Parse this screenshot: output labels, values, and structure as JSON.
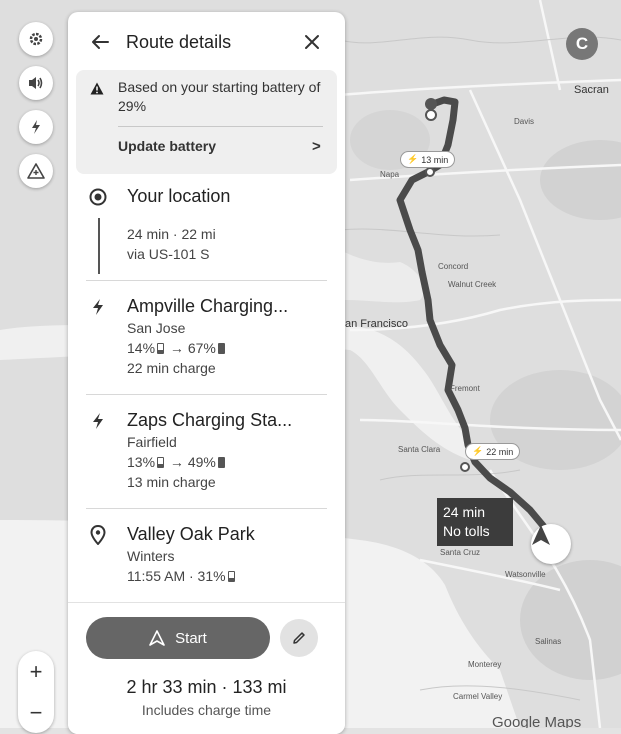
{
  "panel": {
    "title": "Route details",
    "battery_notice": "Based on your starting battery of 29%",
    "update_battery_label": "Update battery",
    "update_chevron": ">",
    "stops": [
      {
        "name": "Your location",
        "leg_time": "24 min · 22 mi",
        "leg_route": "via US-101 S"
      },
      {
        "name": "Ampville Charging...",
        "city": "San Jose",
        "charge_from": "14%",
        "charge_to": "67%",
        "charge_time": "22 min charge"
      },
      {
        "name": "Zaps Charging Sta...",
        "city": "Fairfield",
        "charge_from": "13%",
        "charge_to": "49%",
        "charge_time": "13 min charge"
      },
      {
        "name": "Valley Oak Park",
        "city": "Winters",
        "arrival": "11:55 AM · 31%"
      }
    ],
    "start_label": "Start",
    "total": "2 hr 33 min · 133 mi",
    "total_note": "Includes charge time"
  },
  "map": {
    "avatar_letter": "C",
    "charger_bubbles": [
      "13 min",
      "22 min"
    ],
    "eta_time": "24 min",
    "eta_note": "No tolls",
    "brand": "Google Maps",
    "labels": {
      "sacramento": "Sacran",
      "san_francisco": "an Francisco",
      "concord": "Concord",
      "walnut_creek": "Walnut Creek",
      "fremont": "Fremont",
      "santa_clara": "Santa Clara",
      "santa_cruz": "Santa Cruz",
      "watsonville": "Watsonville",
      "salinas": "Salinas",
      "monterey": "Monterey",
      "carmel_valley": "Carmel Valley",
      "napa": "Napa",
      "davis": "Davis"
    }
  },
  "controls": {
    "zoom_in": "+",
    "zoom_out": "−"
  },
  "colors": {
    "route": "#4a4a4a",
    "water": "#f2f2f2",
    "land": "#dcdcdc",
    "start_button": "#666666"
  },
  "icons": [
    "settings-icon",
    "volume-icon",
    "ev-charger-icon",
    "warning-add-icon",
    "back-arrow-icon",
    "close-icon",
    "warning-icon",
    "location-target-icon",
    "bolt-icon",
    "place-pin-icon",
    "navigation-icon",
    "pencil-icon"
  ]
}
